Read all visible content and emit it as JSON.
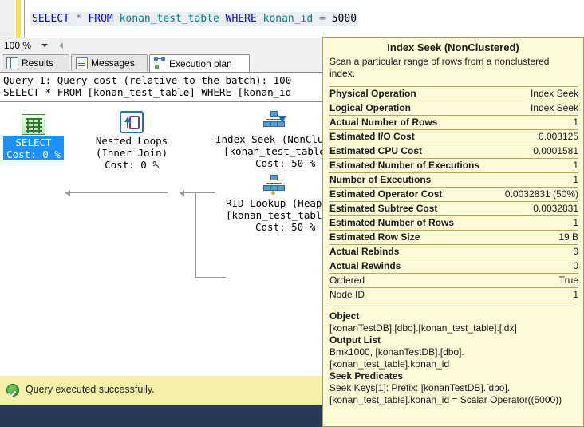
{
  "editor": {
    "query_tokens": [
      {
        "t": "SELECT",
        "c": "kw"
      },
      {
        "t": " ",
        "c": "plain"
      },
      {
        "t": "*",
        "c": "op"
      },
      {
        "t": " ",
        "c": "plain"
      },
      {
        "t": "FROM",
        "c": "kw"
      },
      {
        "t": " ",
        "c": "plain"
      },
      {
        "t": "konan_test_table",
        "c": "ident"
      },
      {
        "t": " ",
        "c": "plain"
      },
      {
        "t": "WHERE",
        "c": "kw"
      },
      {
        "t": " ",
        "c": "plain"
      },
      {
        "t": "konan_id",
        "c": "ident"
      },
      {
        "t": " ",
        "c": "plain"
      },
      {
        "t": "=",
        "c": "op"
      },
      {
        "t": " ",
        "c": "plain"
      },
      {
        "t": "5000",
        "c": "num"
      }
    ],
    "query_text": "SELECT * FROM konan_test_table WHERE konan_id = 5000"
  },
  "zoombar": {
    "zoom_level": "100 %"
  },
  "tabs": [
    {
      "label": "Results",
      "icon": "grid-icon",
      "active": false
    },
    {
      "label": "Messages",
      "icon": "message-icon",
      "active": false
    },
    {
      "label": "Execution plan",
      "icon": "execution-plan-icon",
      "active": true
    }
  ],
  "plan": {
    "header_line1": "Query 1: Query cost (relative to the batch): 100",
    "header_line2": "SELECT * FROM [konan_test_table] WHERE [konan_id",
    "nodes": [
      {
        "id": "select",
        "icon": "select-result-icon",
        "lines": [
          "SELECT",
          "Cost: 0 %"
        ],
        "selected": true
      },
      {
        "id": "nested-loops",
        "icon": "nested-loops-icon",
        "lines": [
          "Nested Loops",
          "(Inner Join)",
          "Cost: 0 %"
        ],
        "selected": false
      },
      {
        "id": "index-seek",
        "icon": "index-seek-icon",
        "lines": [
          "Index Seek (NonCluster",
          "[konan_test_table].[i",
          "Cost: 50 %"
        ],
        "selected": false
      },
      {
        "id": "rid-lookup",
        "icon": "rid-lookup-icon",
        "lines": [
          "RID Lookup (Heap)",
          "[konan_test_table]",
          "Cost: 50 %"
        ],
        "selected": false
      }
    ]
  },
  "tooltip": {
    "title": "Index Seek (NonClustered)",
    "description": "Scan a particular range of rows from a nonclustered index.",
    "properties": [
      {
        "key": "Physical Operation",
        "value": "Index Seek",
        "bold": true
      },
      {
        "key": "Logical Operation",
        "value": "Index Seek",
        "bold": true
      },
      {
        "key": "Actual Number of Rows",
        "value": "1",
        "bold": true
      },
      {
        "key": "Estimated I/O Cost",
        "value": "0.003125",
        "bold": true
      },
      {
        "key": "Estimated CPU Cost",
        "value": "0.0001581",
        "bold": true
      },
      {
        "key": "Estimated Number of Executions",
        "value": "1",
        "bold": true
      },
      {
        "key": "Number of Executions",
        "value": "1",
        "bold": true
      },
      {
        "key": "Estimated Operator Cost",
        "value": "0.0032831 (50%)",
        "bold": true
      },
      {
        "key": "Estimated Subtree Cost",
        "value": "0.0032831",
        "bold": true
      },
      {
        "key": "Estimated Number of Rows",
        "value": "1",
        "bold": true
      },
      {
        "key": "Estimated Row Size",
        "value": "19 B",
        "bold": true
      },
      {
        "key": "Actual Rebinds",
        "value": "0",
        "bold": true
      },
      {
        "key": "Actual Rewinds",
        "value": "0",
        "bold": true
      },
      {
        "key": "Ordered",
        "value": "True",
        "bold": false
      },
      {
        "key": "Node ID",
        "value": "1",
        "bold": false
      }
    ],
    "sections": [
      {
        "heading": "Object",
        "body": [
          "[konanTestDB].[dbo].[konan_test_table].[idx]"
        ]
      },
      {
        "heading": "Output List",
        "body": [
          "Bmk1000, [konanTestDB].[dbo].",
          "[konan_test_table].konan_id"
        ]
      },
      {
        "heading": "Seek Predicates",
        "body": [
          "Seek Keys[1]: Prefix: [konanTestDB].[dbo].",
          "[konan_test_table].konan_id = Scalar Operator((5000))"
        ]
      }
    ]
  },
  "status": {
    "message": "Query executed successfully.",
    "icon": "success-check-icon"
  },
  "colors": {
    "tooltip_bg": "#fdfbd7",
    "status_bg": "#f5f0a9",
    "selection_blue": "#1e90ff",
    "bottom_bar": "#293955"
  }
}
